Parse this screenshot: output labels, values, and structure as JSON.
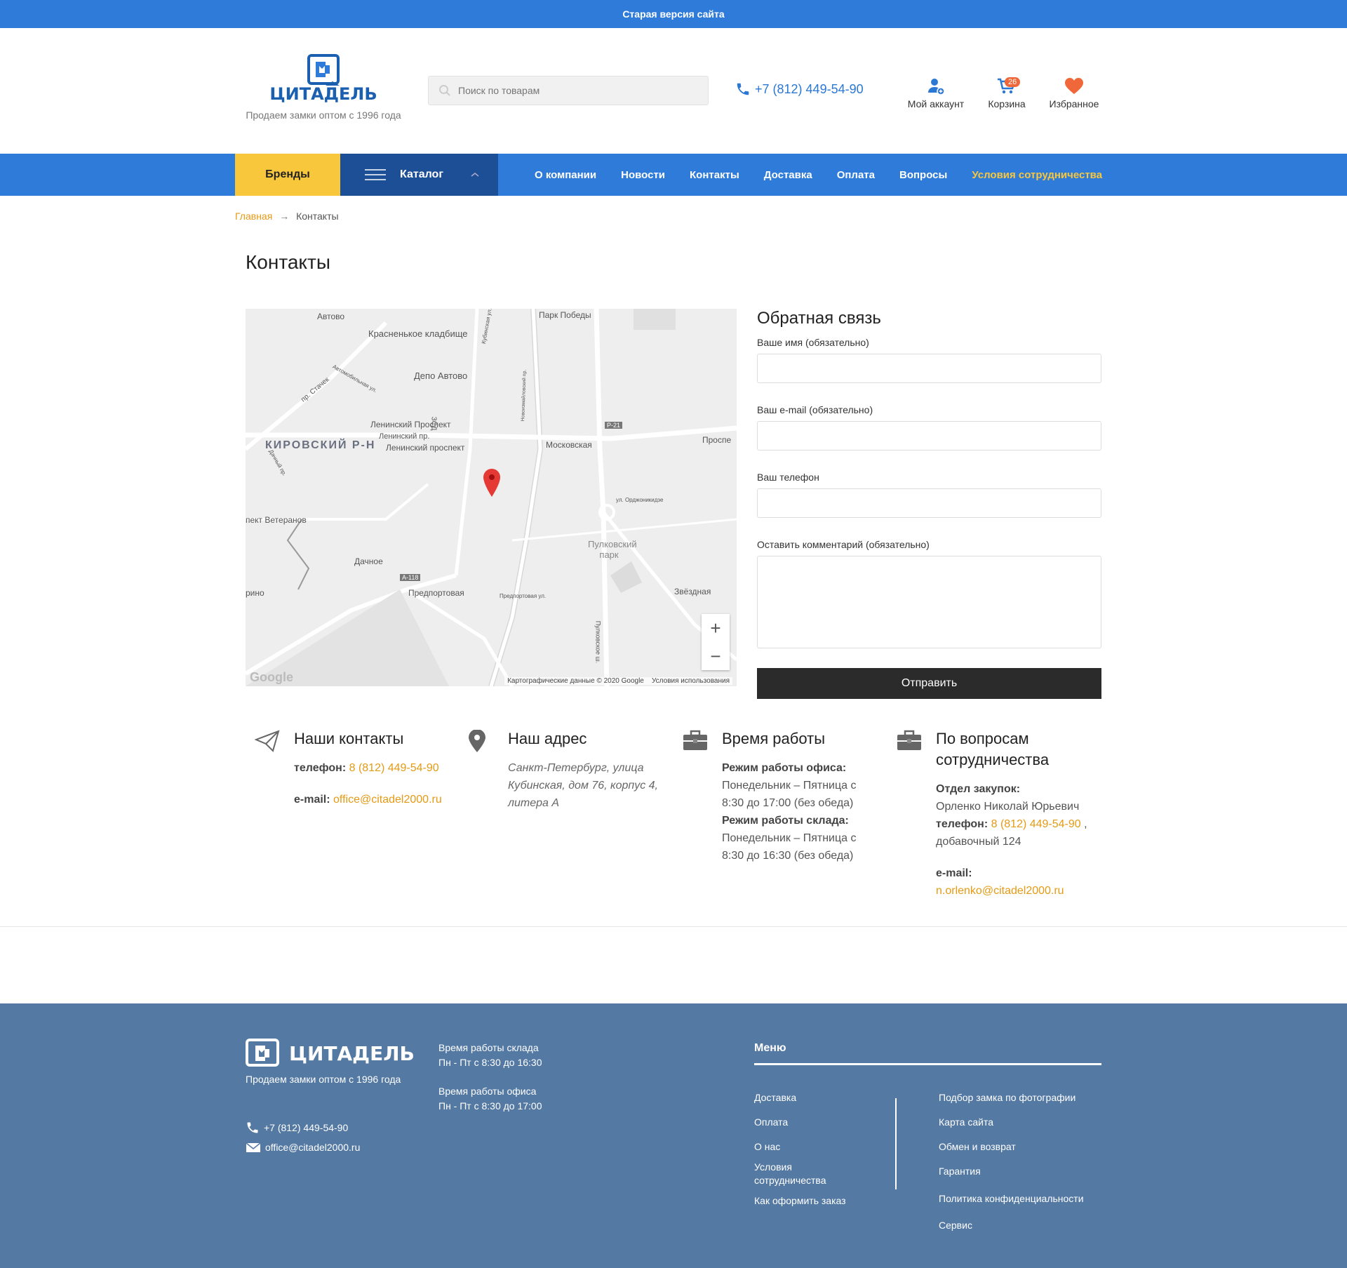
{
  "topbar": {
    "label": "Старая версия сайта"
  },
  "header": {
    "brand": "ЦИТАДЕЛЬ",
    "tagline": "Продаем замки оптом с 1996 года",
    "search_placeholder": "Поиск по товарам",
    "phone": "+7 (812) 449-54-90",
    "account_label": "Мой аккаунт",
    "cart_label": "Корзина",
    "cart_count": "26",
    "favorites_label": "Избранное"
  },
  "nav": {
    "brands": "Бренды",
    "catalog": "Каталог",
    "items": [
      "О компании",
      "Новости",
      "Контакты",
      "Доставка",
      "Оплата",
      "Вопросы",
      "Условия сотрудничества"
    ]
  },
  "breadcrumb": {
    "home": "Главная",
    "arrow": "→",
    "current": "Контакты"
  },
  "page_title": "Контакты",
  "map": {
    "labels": [
      "Автово",
      "Красненькое кладбище",
      "Парк Победы",
      "Депо Автово",
      "пр. Стачек",
      "Автомобильная ул.",
      "Ленинский Проспект",
      "Ленинский пр.",
      "КИРОВСКИЙ Р-Н",
      "Ленинский проспект",
      "Московская",
      "Р-21",
      "Проспе",
      "Дачный пр.",
      "ул. Орджоникидзе",
      "пект Ветеранов",
      "Дачное",
      "Пулковский парк",
      "А-118",
      "Предпортовая",
      "Звёздная",
      "Предпортовая ул.",
      "Пулковское ш.",
      "рино",
      "ЗСД",
      "Кубинская ул.",
      "Новоизмайловский пр."
    ],
    "copyright": "Картографические данные © 2020 Google",
    "terms": "Условия использования",
    "google": "Google",
    "zoom_in": "+",
    "zoom_out": "−"
  },
  "form": {
    "title": "Обратная связь",
    "name_label": "Ваше имя (обязательно)",
    "email_label": "Ваш e-mail (обязательно)",
    "phone_label": "Ваш телефон",
    "comment_label": "Оставить комментарий (обязательно)",
    "submit": "Отправить"
  },
  "contacts": {
    "title": "Наши контакты",
    "phone_label": "телефон:",
    "phone": "8 (812) 449-54-90",
    "email_label": "e-mail:",
    "email": "office@citadel2000.ru"
  },
  "address": {
    "title": "Наш адрес",
    "text": "Санкт-Петербург, улица Кубинская, дом 76, корпус 4, литера А"
  },
  "hours": {
    "title": "Время работы",
    "office_label": "Режим работы офиса:",
    "office": "Понедельник – Пятница с 8:30 до 17:00 (без обеда)",
    "warehouse_label": "Режим работы склада:",
    "warehouse": "Понедельник – Пятница с 8:30 до 16:30 (без обеда)"
  },
  "cooperation": {
    "title": "По вопросам сотрудничества",
    "dept_label": "Отдел закупок:",
    "person": "Орленко Николай Юрьевич",
    "phone_label": "телефон:",
    "phone": "8 (812) 449-54-90",
    "ext": " , добавочный 124",
    "email_label": "e-mail:",
    "email": "n.orlenko@citadel2000.ru"
  },
  "footer": {
    "brand": "ЦИТАДЕЛЬ",
    "tagline": "Продаем замки оптом с 1996 года",
    "phone": "+7 (812) 449-54-90",
    "email": "office@citadel2000.ru",
    "warehouse_title": "Время работы склада",
    "warehouse_hours": "Пн - Пт с 8:30 до 16:30",
    "office_title": "Время работы офиса",
    "office_hours": "Пн - Пт с 8:30 до 17:00",
    "menu_title": "Меню",
    "menu_left": [
      "Доставка",
      "Оплата",
      "О нас",
      "Условия сотрудничества",
      "Как оформить заказ"
    ],
    "menu_right": [
      "Подбор замка по фотографии",
      "Карта сайта",
      "Обмен и возврат",
      "Гарантия",
      "Политика конфиденциальности",
      "Сервис"
    ]
  },
  "colors": {
    "accent": "#2f7bd9",
    "brand_dark": "#1c4f96",
    "yellow": "#f9c73c",
    "link": "#e59a14",
    "footer": "#5479a3"
  }
}
